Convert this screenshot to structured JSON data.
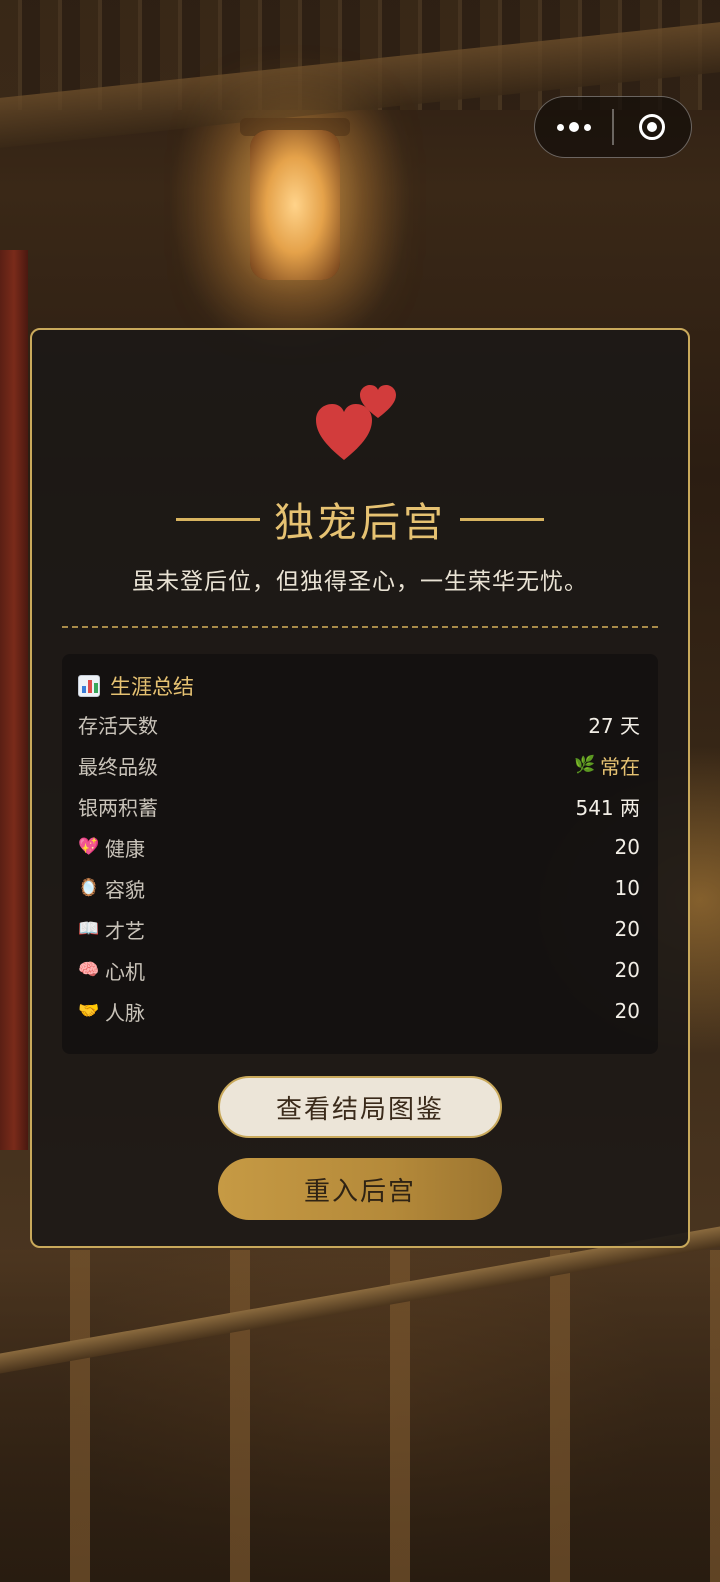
{
  "capsule": {
    "more_icon": "more-dots-icon",
    "close_icon": "target-circle-icon"
  },
  "ending": {
    "icon": "two-hearts-icon",
    "title": "独宠后宫",
    "description": "虽未登后位，但独得圣心，一生荣华无忧。"
  },
  "summary": {
    "icon": "bar-chart-icon",
    "title": "生涯总结",
    "days_label": "存活天数",
    "days_value": "27 天",
    "rank_label": "最终品级",
    "rank_icon": "🌿",
    "rank_value": "常在",
    "silver_label": "银两积蓄",
    "silver_value": "541 两",
    "stats": [
      {
        "icon": "💖",
        "label": "健康",
        "value": "20"
      },
      {
        "icon": "🪞",
        "label": "容貌",
        "value": "10"
      },
      {
        "icon": "📖",
        "label": "才艺",
        "value": "20"
      },
      {
        "icon": "🧠",
        "label": "心机",
        "value": "20"
      },
      {
        "icon": "🤝",
        "label": "人脉",
        "value": "20"
      }
    ]
  },
  "buttons": {
    "gallery": "查看结局图鉴",
    "restart": "重入后宫"
  },
  "colors": {
    "gold": "#e6c272",
    "card_border": "#c9a95b",
    "heart": "#d23c3c"
  }
}
